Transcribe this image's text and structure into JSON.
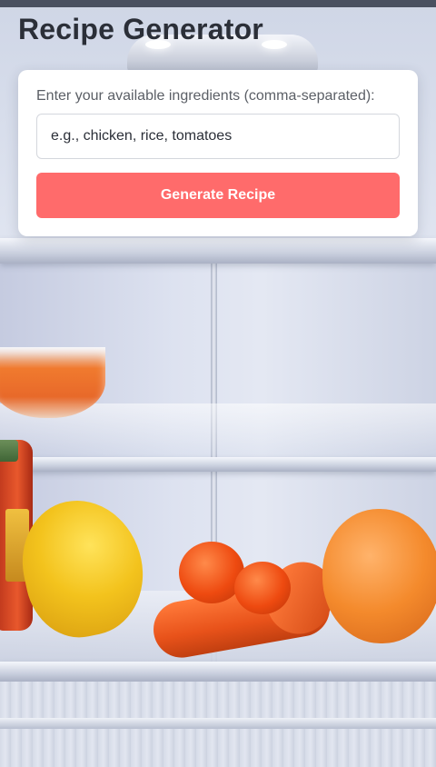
{
  "header": {
    "title": "Recipe Generator"
  },
  "form": {
    "label": "Enter your available ingredients (comma-separated):",
    "input_value": "",
    "input_placeholder": "e.g., chicken, rice, tomatoes",
    "button_label": "Generate Recipe"
  },
  "theme": {
    "accent": "#ff6b6b",
    "title_color": "#2b2f38",
    "card_background": "#ffffff"
  },
  "background": {
    "description_icon": "fridge-interior-photo"
  }
}
